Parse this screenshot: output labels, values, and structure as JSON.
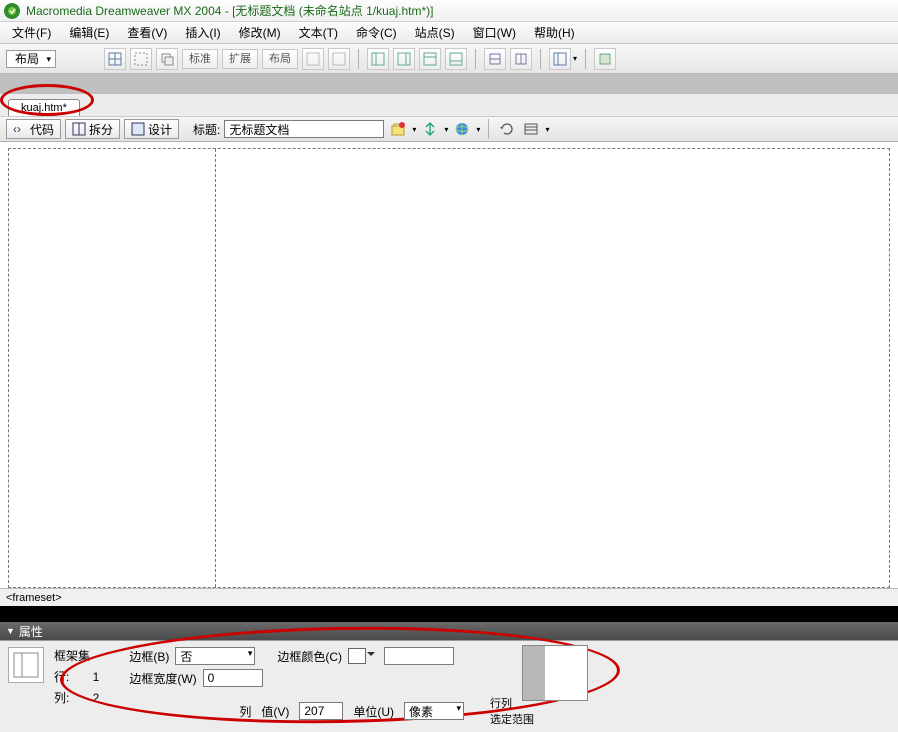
{
  "titlebar": {
    "app": "Macromedia Dreamweaver MX 2004",
    "doc": "[无标题文档 (未命名站点 1/kuaj.htm*)]"
  },
  "menu": {
    "file": "文件(F)",
    "edit": "编辑(E)",
    "view": "查看(V)",
    "insert": "插入(I)",
    "modify": "修改(M)",
    "text": "文本(T)",
    "commands": "命令(C)",
    "site": "站点(S)",
    "window": "窗口(W)",
    "help": "帮助(H)"
  },
  "layoutbar": {
    "category": "布局",
    "std": "标准",
    "ext": "扩展",
    "lay": "布局"
  },
  "doctab": {
    "name": "kuaj.htm*"
  },
  "doctoolbar": {
    "code": "代码",
    "split": "拆分",
    "design": "设计",
    "title_label": "标题:",
    "title_value": "无标题文档"
  },
  "tagselector": "<frameset>",
  "properties": {
    "panel_title": "属性",
    "frameset_label": "框架集",
    "rows_label": "行:",
    "rows_value": "1",
    "cols_label": "列:",
    "cols_value": "2",
    "border_label": "边框(B)",
    "border_value": "否",
    "bordercolor_label": "边框颜色(C)",
    "borderwidth_label": "边框宽度(W)",
    "borderwidth_value": "0",
    "value_label": "值(V)",
    "value_value": "207",
    "unit_label": "单位(U)",
    "unit_value": "像素",
    "col_label": "列",
    "rowcol_label": "行列",
    "selrange_label": "选定范围"
  }
}
